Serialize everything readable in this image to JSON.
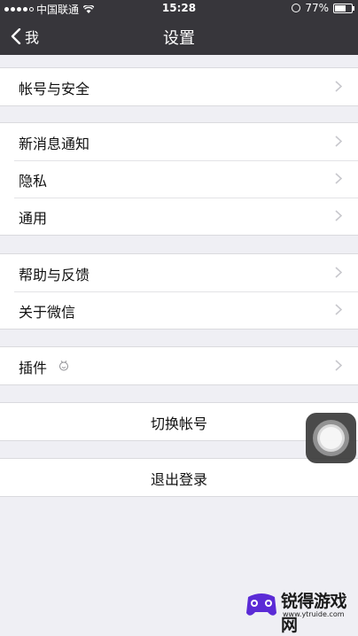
{
  "status_bar": {
    "carrier": "中国联通",
    "time": "15:28",
    "battery": "77%",
    "battery_level": 0.77
  },
  "nav": {
    "back_label": "我",
    "title": "设置"
  },
  "groups": [
    {
      "items": [
        {
          "label": "帐号与安全"
        }
      ]
    },
    {
      "items": [
        {
          "label": "新消息通知"
        },
        {
          "label": "隐私"
        },
        {
          "label": "通用"
        }
      ]
    },
    {
      "items": [
        {
          "label": "帮助与反馈"
        },
        {
          "label": "关于微信"
        }
      ]
    },
    {
      "items": [
        {
          "label": "插件"
        }
      ]
    }
  ],
  "actions": {
    "switch_account": "切换帐号",
    "logout": "退出登录"
  },
  "watermark": {
    "name": "锐得游戏网",
    "url": "www.ytruide.com"
  },
  "colors": {
    "nav_bg": "#37363b",
    "page_bg": "#efeff4",
    "chevron": "#c7c7cc"
  }
}
